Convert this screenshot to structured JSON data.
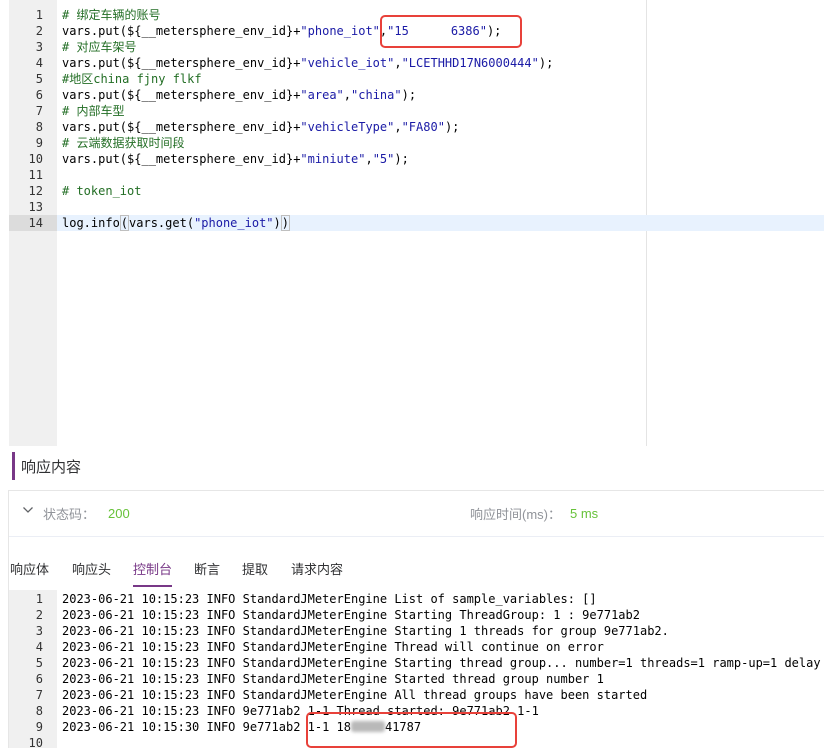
{
  "editor": {
    "lines": [
      {
        "n": "1",
        "parts": [
          {
            "t": "# 绑定车辆的账号",
            "c": "cm"
          }
        ]
      },
      {
        "n": "2",
        "parts": [
          {
            "t": "vars.put(${__metersphere_env_id}+",
            "c": ""
          },
          {
            "t": "\"phone_iot\"",
            "c": "str"
          },
          {
            "t": ",",
            "c": ""
          },
          {
            "t": "\"15",
            "c": "str"
          },
          {
            "t": "",
            "c": "gap"
          },
          {
            "t": "6386\"",
            "c": "str"
          },
          {
            "t": ");",
            "c": ""
          }
        ]
      },
      {
        "n": "3",
        "parts": [
          {
            "t": "# 对应车架号",
            "c": "cm"
          }
        ]
      },
      {
        "n": "4",
        "parts": [
          {
            "t": "vars.put(${__metersphere_env_id}+",
            "c": ""
          },
          {
            "t": "\"vehicle_iot\"",
            "c": "str"
          },
          {
            "t": ",",
            "c": ""
          },
          {
            "t": "\"LCETHHD17N6000444\"",
            "c": "str"
          },
          {
            "t": ");",
            "c": ""
          }
        ]
      },
      {
        "n": "5",
        "parts": [
          {
            "t": "#地区china fjny flkf",
            "c": "cm"
          }
        ]
      },
      {
        "n": "6",
        "parts": [
          {
            "t": "vars.put(${__metersphere_env_id}+",
            "c": ""
          },
          {
            "t": "\"area\"",
            "c": "str"
          },
          {
            "t": ",",
            "c": ""
          },
          {
            "t": "\"china\"",
            "c": "str"
          },
          {
            "t": ");",
            "c": ""
          }
        ]
      },
      {
        "n": "7",
        "parts": [
          {
            "t": "# 内部车型",
            "c": "cm"
          }
        ]
      },
      {
        "n": "8",
        "parts": [
          {
            "t": "vars.put(${__metersphere_env_id}+",
            "c": ""
          },
          {
            "t": "\"vehicleType\"",
            "c": "str"
          },
          {
            "t": ",",
            "c": ""
          },
          {
            "t": "\"FA80\"",
            "c": "str"
          },
          {
            "t": ");",
            "c": ""
          }
        ]
      },
      {
        "n": "9",
        "parts": [
          {
            "t": "# 云端数据获取时间段",
            "c": "cm"
          }
        ]
      },
      {
        "n": "10",
        "parts": [
          {
            "t": "vars.put(${__metersphere_env_id}+",
            "c": ""
          },
          {
            "t": "\"miniute\"",
            "c": "str"
          },
          {
            "t": ",",
            "c": ""
          },
          {
            "t": "\"5\"",
            "c": "str"
          },
          {
            "t": ");",
            "c": ""
          }
        ]
      },
      {
        "n": "11",
        "parts": []
      },
      {
        "n": "12",
        "parts": [
          {
            "t": "# token_iot",
            "c": "cm"
          }
        ]
      },
      {
        "n": "13",
        "parts": []
      },
      {
        "n": "14",
        "parts": [
          {
            "t": "log.info",
            "c": ""
          },
          {
            "t": "(",
            "c": "cur"
          },
          {
            "t": "vars.get(",
            "c": ""
          },
          {
            "t": "\"phone_iot\"",
            "c": "str"
          },
          {
            "t": ")",
            "c": ""
          },
          {
            "t": ")",
            "c": "cur"
          }
        ],
        "active": true
      }
    ]
  },
  "response": {
    "title": "响应内容",
    "status_label": "状态码：",
    "status_code": "200",
    "time_label": "响应时间(ms)：",
    "time_value": "5 ms",
    "tabs": [
      {
        "label": "响应体",
        "active": false
      },
      {
        "label": "响应头",
        "active": false
      },
      {
        "label": "控制台",
        "active": true
      },
      {
        "label": "断言",
        "active": false
      },
      {
        "label": "提取",
        "active": false
      },
      {
        "label": "请求内容",
        "active": false
      }
    ]
  },
  "console": {
    "lines": [
      {
        "n": "1",
        "text": "2023-06-21 10:15:23 INFO StandardJMeterEngine List of sample_variables: []"
      },
      {
        "n": "2",
        "text": "2023-06-21 10:15:23 INFO StandardJMeterEngine Starting ThreadGroup: 1 : 9e771ab2"
      },
      {
        "n": "3",
        "text": "2023-06-21 10:15:23 INFO StandardJMeterEngine Starting 1 threads for group 9e771ab2."
      },
      {
        "n": "4",
        "text": "2023-06-21 10:15:23 INFO StandardJMeterEngine Thread will continue on error"
      },
      {
        "n": "5",
        "text": "2023-06-21 10:15:23 INFO StandardJMeterEngine Starting thread group... number=1 threads=1 ramp-up=1 delay"
      },
      {
        "n": "6",
        "text": "2023-06-21 10:15:23 INFO StandardJMeterEngine Started thread group number 1"
      },
      {
        "n": "7",
        "text": "2023-06-21 10:15:23 INFO StandardJMeterEngine All thread groups have been started"
      },
      {
        "n": "8",
        "text": "2023-06-21 10:15:23 INFO 9e771ab2 1-1 Thread started: 9e771ab2 1-1"
      },
      {
        "n": "9",
        "text_before": "2023-06-21 10:15:30 INFO 9e771ab2 1-1 18",
        "text_after": "41787"
      },
      {
        "n": "10",
        "text": ""
      }
    ]
  },
  "colors": {
    "accent": "#783887",
    "success": "#67c23a",
    "highlight_box": "#e8413a",
    "comment": "#236e25",
    "string": "#1a1aa6"
  },
  "icons": {
    "collapse": "chevron-down-icon"
  }
}
